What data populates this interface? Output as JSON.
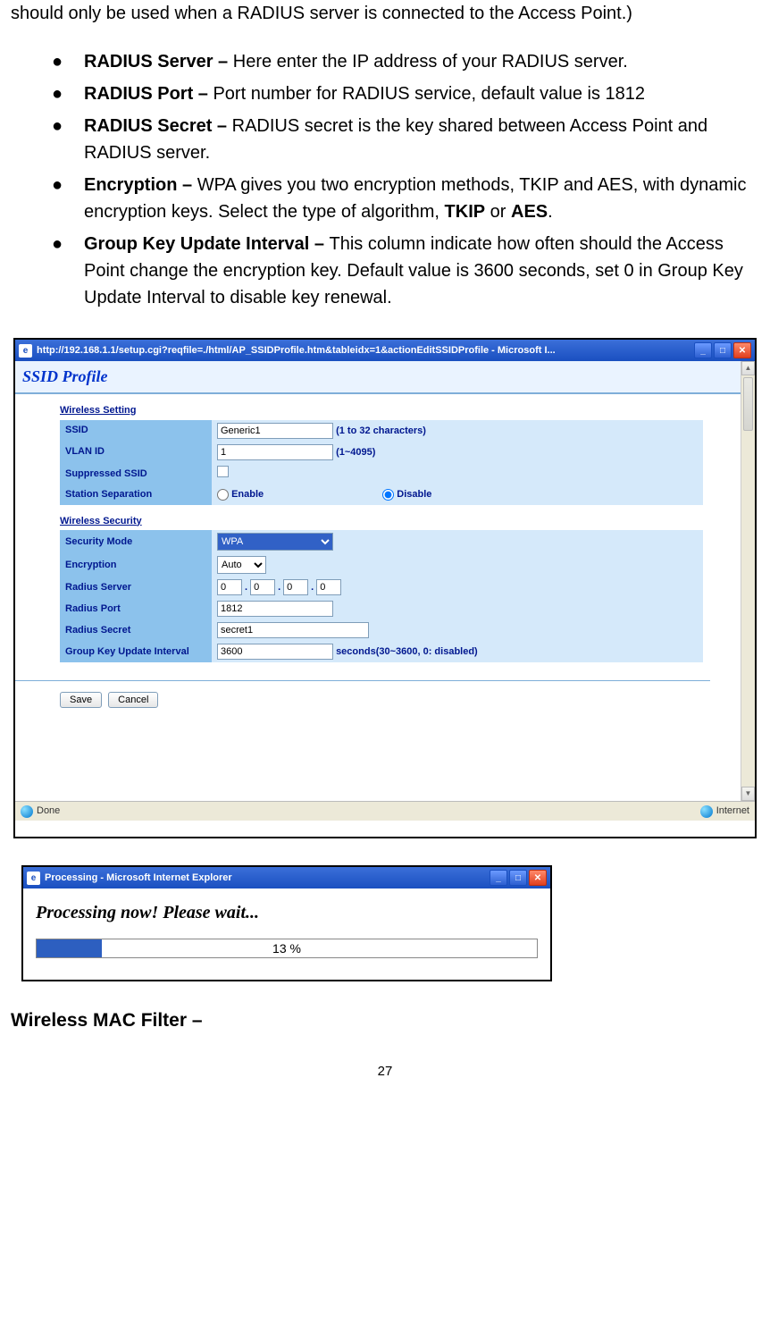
{
  "intro": "should only be used when a RADIUS server is connected to the Access Point.)",
  "bullets": [
    {
      "term": "RADIUS Server – ",
      "desc": "Here enter the IP address of your RADIUS server."
    },
    {
      "term": "RADIUS Port – ",
      "desc": "Port number for RADIUS service, default value is 1812"
    },
    {
      "term": "RADIUS Secret – ",
      "desc": "RADIUS secret is the key shared between Access Point and RADIUS server."
    },
    {
      "term": "Encryption – ",
      "desc_prefix": "WPA gives you two encryption methods, TKIP and AES, with dynamic encryption keys. Select the type of algorithm, ",
      "bold1": "TKIP",
      "mid": " or ",
      "bold2": "AES",
      "suffix": "."
    },
    {
      "term": "Group Key Update Interval – ",
      "desc": "This column indicate how often should the Access Point change the encryption key. Default value is 3600 seconds, set 0 in Group Key Update Interval to disable key renewal."
    }
  ],
  "window1": {
    "title": "http://192.168.1.1/setup.cgi?reqfile=./html/AP_SSIDProfile.htm&tableidx=1&actionEditSSIDProfile - Microsoft I...",
    "header": "SSID Profile",
    "section1": "Wireless Setting",
    "rows1": {
      "ssid_label": "SSID",
      "ssid_value": "Generic1",
      "ssid_hint": "(1 to 32 characters)",
      "vlan_label": "VLAN ID",
      "vlan_value": "1",
      "vlan_hint": "(1~4095)",
      "suppressed_label": "Suppressed SSID",
      "station_label": "Station Separation",
      "enable": "Enable",
      "disable": "Disable"
    },
    "section2": "Wireless Security",
    "rows2": {
      "secmode_label": "Security Mode",
      "secmode_value": "WPA",
      "enc_label": "Encryption",
      "enc_value": "Auto",
      "rserver_label": "Radius Server",
      "ip1": "0",
      "ip2": "0",
      "ip3": "0",
      "ip4": "0",
      "rport_label": "Radius Port",
      "rport_value": "1812",
      "rsecret_label": "Radius Secret",
      "rsecret_value": "secret1",
      "gkey_label": "Group Key Update Interval",
      "gkey_value": "3600",
      "gkey_hint": "seconds(30~3600, 0: disabled)"
    },
    "buttons": {
      "save": "Save",
      "cancel": "Cancel"
    },
    "status_left": "Done",
    "status_right": "Internet"
  },
  "window2": {
    "title": "Processing - Microsoft Internet Explorer",
    "message": "Processing now! Please wait...",
    "percent_value": 13,
    "percent_label": "13 %"
  },
  "heading_after": "Wireless MAC Filter –",
  "page_number": "27"
}
